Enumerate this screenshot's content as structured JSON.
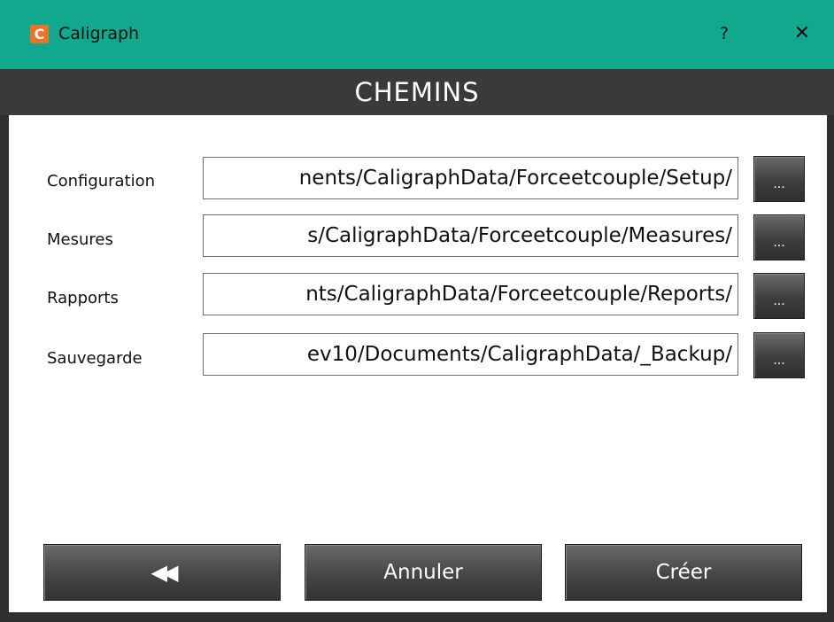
{
  "window": {
    "title": "Caligraph",
    "app_icon": "caligraph-app-icon",
    "app_icon_letter": "C",
    "help_label": "?",
    "close_glyph": "✕"
  },
  "header": {
    "title": "CHEMINS"
  },
  "paths": [
    {
      "label": "Configuration",
      "value": "nents/CaligraphData/Forceetcouple/Setup/",
      "browse_label": "..."
    },
    {
      "label": "Mesures",
      "value": "s/CaligraphData/Forceetcouple/Measures/",
      "browse_label": "..."
    },
    {
      "label": "Rapports",
      "value": "nts/CaligraphData/Forceetcouple/Reports/",
      "browse_label": "..."
    },
    {
      "label": "Sauvegarde",
      "value": "ev10/Documents/CaligraphData/_Backup/",
      "browse_label": "..."
    }
  ],
  "footer": {
    "back_glyph": "◀◀",
    "back_icon": "double-chevron-left-icon",
    "cancel_label": "Annuler",
    "create_label": "Créer"
  },
  "colors": {
    "titlebar": "#12a88e",
    "header": "#3a3a3a",
    "button": "#454545",
    "app_icon": "#e8742a"
  }
}
